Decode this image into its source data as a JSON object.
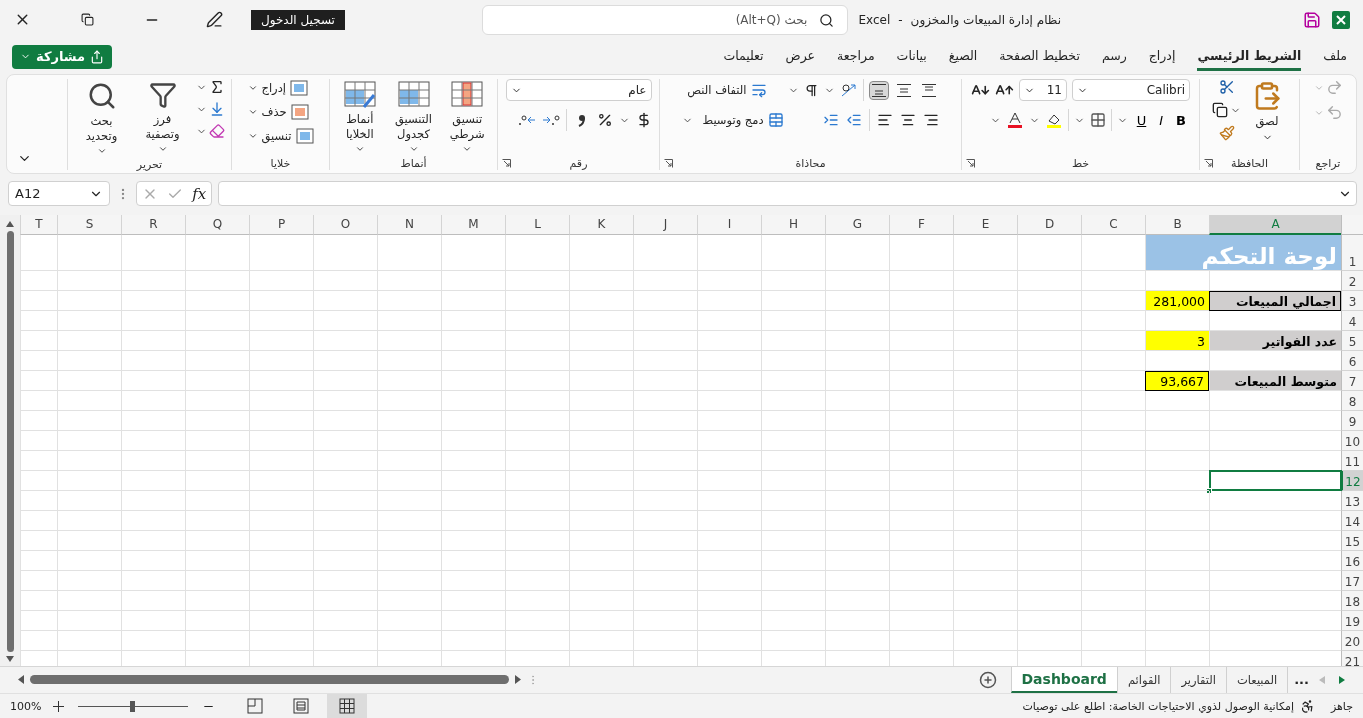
{
  "title_bar": {
    "document_title": "نظام إدارة المبيعات والمخزون",
    "separator": "-",
    "app_name": "Excel",
    "search": {
      "placeholder": "بحث (Alt+Q)"
    },
    "sign_in": "تسجيل الدخول"
  },
  "menu_tabs": [
    {
      "label": "ملف",
      "selected": false
    },
    {
      "label": "الشريط الرئيسي",
      "selected": true
    },
    {
      "label": "إدراج",
      "selected": false
    },
    {
      "label": "رسم",
      "selected": false
    },
    {
      "label": "تخطيط الصفحة",
      "selected": false
    },
    {
      "label": "الصيغ",
      "selected": false
    },
    {
      "label": "بيانات",
      "selected": false
    },
    {
      "label": "مراجعة",
      "selected": false
    },
    {
      "label": "عرض",
      "selected": false
    },
    {
      "label": "تعليمات",
      "selected": false
    }
  ],
  "share_button": "مشاركة",
  "ribbon": {
    "groups": [
      {
        "kind": "undo",
        "label": "تراجع"
      },
      {
        "kind": "clipboard",
        "label": "الحافظة",
        "paste": "لصق"
      },
      {
        "kind": "font",
        "label": "خط",
        "font_name": "Calibri",
        "font_size": "11",
        "bold": "B",
        "italic": "I",
        "underline": "U"
      },
      {
        "kind": "alignment",
        "label": "محاذاة",
        "wrap_text": "التفاف النص",
        "merge_center": "دمج وتوسيط",
        "vertical_align": [
          {
            "selected": false
          },
          {
            "selected": false
          },
          {
            "selected": true
          }
        ]
      },
      {
        "kind": "number",
        "label": "رقم",
        "format": "عام"
      },
      {
        "kind": "styles",
        "label": "أنماط",
        "buttons": [
          "تنسيق شرطي",
          "التنسيق كجدول",
          "أنماط الخلايا"
        ]
      },
      {
        "kind": "cells",
        "label": "خلايا",
        "buttons": [
          "إدراج",
          "حذف",
          "تنسيق"
        ]
      },
      {
        "kind": "editing",
        "label": "تحرير",
        "buttons": [
          "فرز وتصفية",
          "بحث وتحديد"
        ]
      }
    ]
  },
  "formula_bar": {
    "name_box": "A12",
    "function_label": "fx"
  },
  "sheet": {
    "columns": [
      {
        "label": "A",
        "selected": true
      },
      {
        "label": "B",
        "selected": false
      },
      {
        "label": "C",
        "selected": false
      },
      {
        "label": "D",
        "selected": false
      },
      {
        "label": "E",
        "selected": false
      },
      {
        "label": "F",
        "selected": false
      },
      {
        "label": "G",
        "selected": false
      },
      {
        "label": "H",
        "selected": false
      },
      {
        "label": "I",
        "selected": false
      },
      {
        "label": "J",
        "selected": false
      },
      {
        "label": "K",
        "selected": false
      },
      {
        "label": "L",
        "selected": false
      },
      {
        "label": "M",
        "selected": false
      },
      {
        "label": "N",
        "selected": false
      },
      {
        "label": "O",
        "selected": false
      },
      {
        "label": "P",
        "selected": false
      },
      {
        "label": "Q",
        "selected": false
      },
      {
        "label": "R",
        "selected": false
      },
      {
        "label": "S",
        "selected": false
      },
      {
        "label": "T",
        "selected": false
      }
    ],
    "rows": [
      {
        "label": "1",
        "selected": false,
        "cells": [
          {
            "text": "لوحة التحكم",
            "kind": "title",
            "bordered": false
          }
        ]
      },
      {
        "label": "2",
        "selected": false
      },
      {
        "label": "3",
        "selected": false,
        "cells": [
          {
            "text": "اجمالي المبيعات",
            "kind": "label",
            "bordered": true
          },
          {
            "text": "281,000",
            "kind": "value",
            "bordered": false
          }
        ]
      },
      {
        "label": "4",
        "selected": false
      },
      {
        "label": "5",
        "selected": false,
        "cells": [
          {
            "text": "عدد الفواتير",
            "kind": "label",
            "bordered": false
          },
          {
            "text": "3",
            "kind": "value",
            "bordered": false
          }
        ]
      },
      {
        "label": "6",
        "selected": false
      },
      {
        "label": "7",
        "selected": false,
        "cells": [
          {
            "text": "متوسط المبيعات",
            "kind": "label",
            "bordered": false
          },
          {
            "text": "93,667",
            "kind": "value",
            "bordered": true
          }
        ]
      },
      {
        "label": "8",
        "selected": false
      },
      {
        "label": "9",
        "selected": false
      },
      {
        "label": "10",
        "selected": false
      },
      {
        "label": "11",
        "selected": false
      },
      {
        "label": "12",
        "selected": true
      },
      {
        "label": "13",
        "selected": false
      },
      {
        "label": "14",
        "selected": false
      },
      {
        "label": "15",
        "selected": false
      },
      {
        "label": "16",
        "selected": false
      },
      {
        "label": "17",
        "selected": false
      },
      {
        "label": "18",
        "selected": false
      },
      {
        "label": "19",
        "selected": false
      },
      {
        "label": "20",
        "selected": false
      },
      {
        "label": "21",
        "selected": false
      }
    ]
  },
  "sheet_tabs": {
    "more": "...",
    "tabs": [
      {
        "label": "المبيعات",
        "selected": false
      },
      {
        "label": "التقارير",
        "selected": false
      },
      {
        "label": "القوائم",
        "selected": false
      },
      {
        "label": "Dashboard",
        "selected": true
      }
    ]
  },
  "status_bar": {
    "ready": "جاهز",
    "accessibility": "إمكانية الوصول لذوي الاحتياجات الخاصة: اطلع على توصيات",
    "views": [
      {
        "selected": true
      },
      {
        "selected": false
      },
      {
        "selected": false
      }
    ],
    "zoom_slider": {
      "level": 0.5
    },
    "zoom": "100%"
  }
}
